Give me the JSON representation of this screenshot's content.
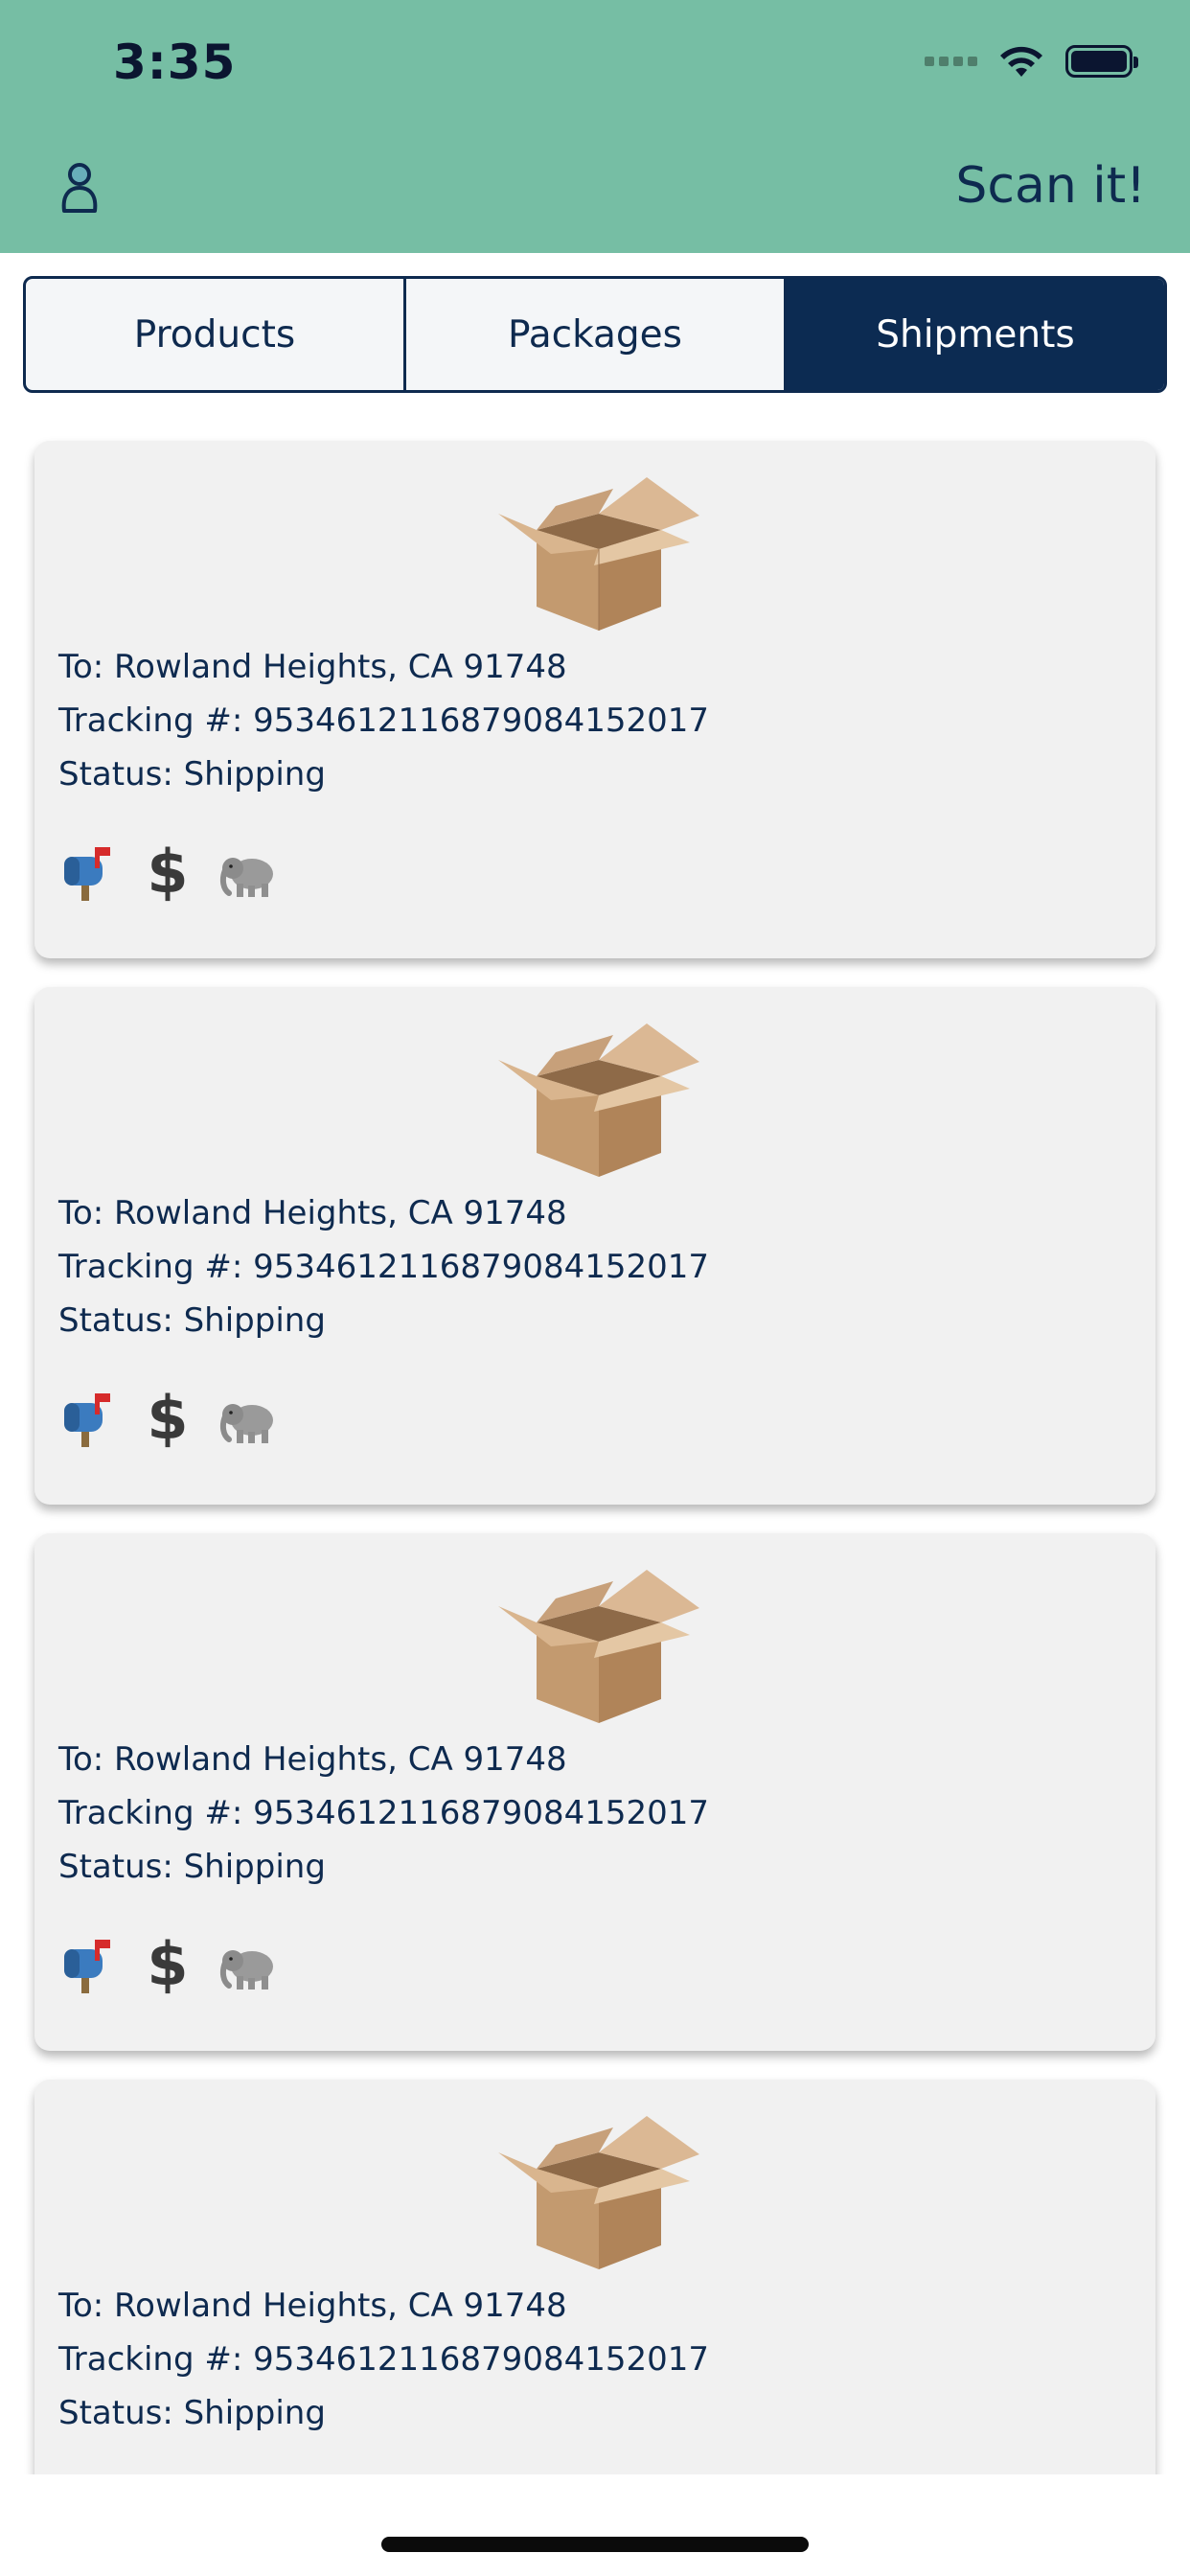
{
  "status_bar": {
    "time": "3:35"
  },
  "header": {
    "scan_label": "Scan it!",
    "accent_color": "#76bea4"
  },
  "tabs": [
    {
      "label": "Products",
      "active": false
    },
    {
      "label": "Packages",
      "active": false
    },
    {
      "label": "Shipments",
      "active": true
    }
  ],
  "shipments": [
    {
      "to": "To: Rowland Heights, CA 91748",
      "tracking": "Tracking #: 9534612116879084152017",
      "status": "Status: Shipping",
      "actions": [
        "mailbox-icon",
        "dollar-icon",
        "elephant-icon"
      ]
    },
    {
      "to": "To: Rowland Heights, CA 91748",
      "tracking": "Tracking #: 9534612116879084152017",
      "status": "Status: Shipping",
      "actions": [
        "mailbox-icon",
        "dollar-icon",
        "elephant-icon"
      ]
    },
    {
      "to": "To: Rowland Heights, CA 91748",
      "tracking": "Tracking #: 9534612116879084152017",
      "status": "Status: Shipping",
      "actions": [
        "mailbox-icon",
        "dollar-icon",
        "elephant-icon"
      ]
    },
    {
      "to": "To: Rowland Heights, CA 91748",
      "tracking": "Tracking #: 9534612116879084152017",
      "status": "Status: Shipping",
      "actions": []
    }
  ],
  "action_labels": {
    "dollar": "$"
  }
}
